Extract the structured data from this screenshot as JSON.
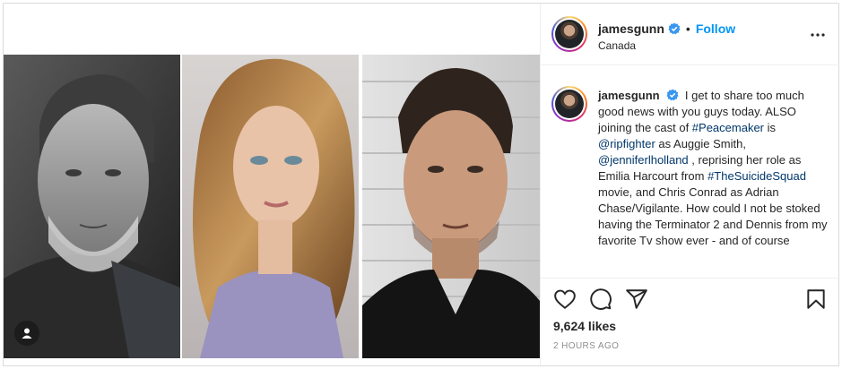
{
  "post": {
    "username": "jamesgunn",
    "follow_label": "Follow",
    "separator": "•",
    "location": "Canada",
    "caption_parts": [
      "I get to share too much good news with you guys today. ALSO joining the cast of ",
      "#Peacemaker",
      " is ",
      "@ripfighter",
      " as Auggie Smith, ",
      "@jenniferlholland",
      " , reprising her role as Emilia Harcourt from ",
      "#TheSuicideSquad",
      " movie, and Chris Conrad as Adrian Chase/Vigilante. How could I not be stoked having the Terminator 2 and Dennis from my favorite Tv show ever - and of course"
    ],
    "likes": "9,624 likes",
    "timestamp": "2 HOURS AGO"
  },
  "colors": {
    "link_blue": "#0095f6",
    "hashtag": "#00376b",
    "border": "#efefef",
    "muted": "#8e8e8e"
  },
  "icons": [
    "verified-badge-icon",
    "more-options-icon",
    "heart-icon",
    "comment-icon",
    "share-icon",
    "bookmark-icon",
    "user-tag-icon"
  ]
}
